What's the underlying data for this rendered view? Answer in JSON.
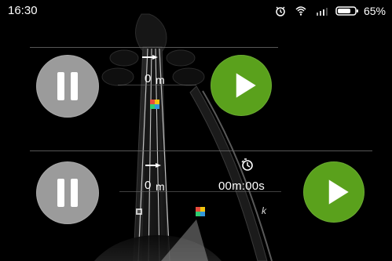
{
  "status_bar": {
    "time": "16:30",
    "battery_percent": "65%",
    "icons": [
      "alarm-icon",
      "wifi-icon",
      "signal-icon",
      "battery-icon"
    ]
  },
  "top_panel": {
    "distance_value": "0",
    "distance_unit": "m",
    "direction_icon": "arrow-right-icon",
    "pause_icon": "pause-icon",
    "play_icon": "play-icon"
  },
  "bottom_panel": {
    "distance_value": "0",
    "distance_unit": "m",
    "timer_value": "00m:00s",
    "direction_icon": "arrow-right-icon",
    "timer_icon": "timer-icon",
    "pause_icon": "pause-icon",
    "play_icon": "play-icon",
    "bottom_icons": [
      "small-square-icon",
      "color-grid-icon",
      "k-icon"
    ],
    "k_label": "k"
  },
  "colors": {
    "background": "#000000",
    "pause_gray": "#9b9b9b",
    "play_green": "#5aa11c",
    "divider_gray": "#6b6b6b",
    "text_white": "#ffffff"
  }
}
